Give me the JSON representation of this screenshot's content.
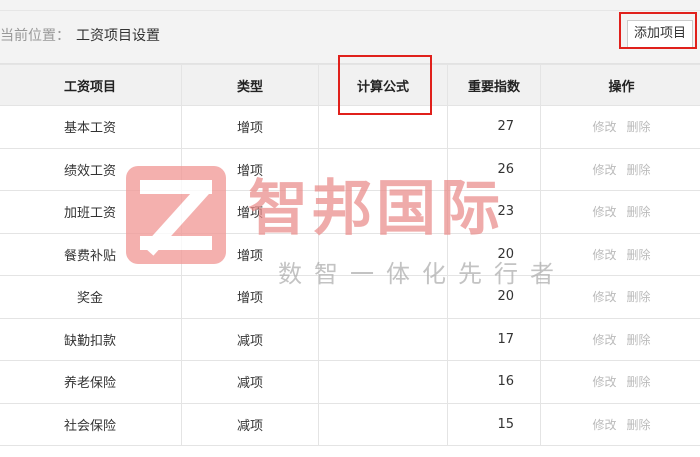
{
  "breadcrumb": {
    "prefix": "当前位置：",
    "current": "工资项目设置"
  },
  "toolbar": {
    "add_label": "添加项目"
  },
  "table": {
    "headers": [
      "工资项目",
      "类型",
      "计算公式",
      "重要指数",
      "操作"
    ],
    "rows": [
      {
        "name": "基本工资",
        "type": "增项",
        "formula": "",
        "index": "27"
      },
      {
        "name": "绩效工资",
        "type": "增项",
        "formula": "",
        "index": "26"
      },
      {
        "name": "加班工资",
        "type": "增项",
        "formula": "",
        "index": "23"
      },
      {
        "name": "餐费补贴",
        "type": "增项",
        "formula": "",
        "index": "20"
      },
      {
        "name": "奖金",
        "type": "增项",
        "formula": "",
        "index": "20"
      },
      {
        "name": "缺勤扣款",
        "type": "减项",
        "formula": "",
        "index": "17"
      },
      {
        "name": "养老保险",
        "type": "减项",
        "formula": "",
        "index": "16"
      },
      {
        "name": "社会保险",
        "type": "减项",
        "formula": "",
        "index": "15"
      }
    ],
    "actions": {
      "edit": "修改",
      "delete": "删除"
    }
  },
  "watermark": {
    "title": "智邦国际",
    "subtitle": "数智一体化先行者"
  },
  "colors": {
    "highlight": "#e0201b",
    "watermark": "#ea8c8a",
    "header_bg": "#f1f1f1"
  }
}
